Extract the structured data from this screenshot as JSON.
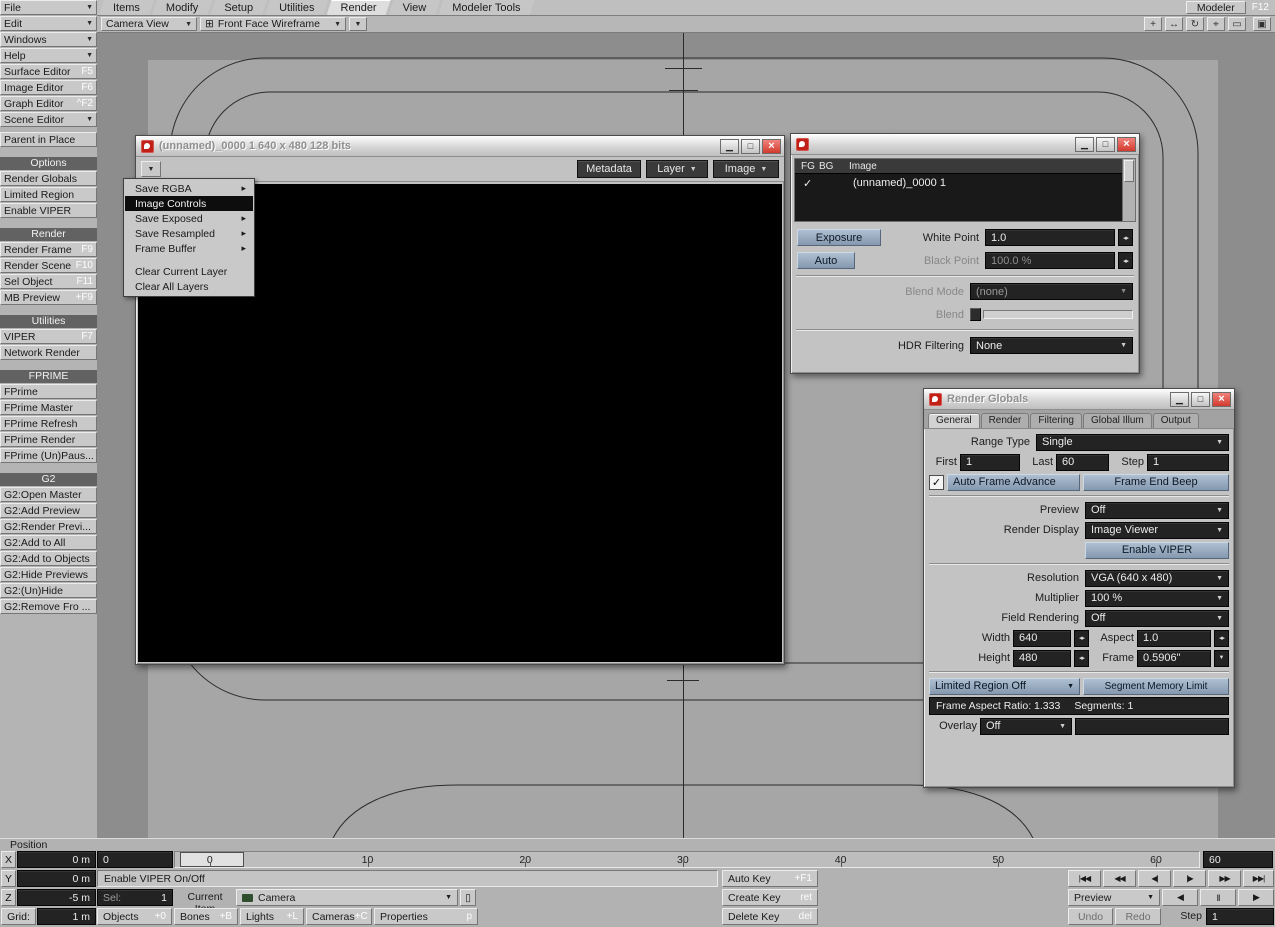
{
  "icons": {
    "dropdown": "▼",
    "dropdown_small": "▾",
    "submenu": "▸",
    "check": "✓",
    "grid_view": "⊞",
    "minimize": "▁",
    "maximize": "□",
    "close": "×",
    "stepper": "◂▸",
    "pan": "+",
    "fit": "↔",
    "rotate": "↻",
    "zoom": "⌖",
    "rect": "▭",
    "single_view": "▣",
    "properties": "▯"
  },
  "menubar": {
    "tabs": [
      "Items",
      "Modify",
      "Setup",
      "Utilities",
      "Render",
      "View",
      "Modeler Tools"
    ],
    "active_tab": "Render",
    "modeler_button": "Modeler",
    "modeler_shortcut": "F12"
  },
  "viewport_toolbar": {
    "view_type": "Camera View",
    "shading": "Front Face Wireframe"
  },
  "sidebar": {
    "menus": [
      "File",
      "Edit",
      "Windows",
      "Help"
    ],
    "items": [
      {
        "label": "Surface Editor",
        "shortcut": "F5"
      },
      {
        "label": "Image Editor",
        "shortcut": "F6"
      },
      {
        "label": "Graph Editor",
        "shortcut": "^F2"
      },
      {
        "label": "Scene Editor",
        "shortcut": ""
      },
      {
        "label": "Parent in Place",
        "shortcut": ""
      },
      {
        "label": "Options"
      },
      {
        "label": "Render Globals",
        "shortcut": ""
      },
      {
        "label": "Limited Region",
        "shortcut": ""
      },
      {
        "label": "Enable VIPER",
        "shortcut": ""
      },
      {
        "label": "Render"
      },
      {
        "label": "Render Frame",
        "shortcut": "F9"
      },
      {
        "label": "Render Scene",
        "shortcut": "F10"
      },
      {
        "label": "Sel Object",
        "shortcut": "F11"
      },
      {
        "label": "MB Preview",
        "shortcut": "+F9"
      },
      {
        "label": "Utilities"
      },
      {
        "label": "VIPER",
        "shortcut": "F7"
      },
      {
        "label": "Network Render",
        "shortcut": ""
      },
      {
        "label": "FPRIME"
      },
      {
        "label": "FPrime",
        "shortcut": ""
      },
      {
        "label": "FPrime Master",
        "shortcut": ""
      },
      {
        "label": "FPrime Refresh",
        "shortcut": ""
      },
      {
        "label": "FPrime Render",
        "shortcut": ""
      },
      {
        "label": "FPrime (Un)Paus...",
        "shortcut": ""
      },
      {
        "label": "G2"
      },
      {
        "label": "G2:Open Master",
        "shortcut": ""
      },
      {
        "label": "G2:Add Preview",
        "shortcut": ""
      },
      {
        "label": "G2:Render Previ...",
        "shortcut": ""
      },
      {
        "label": "G2:Add to All",
        "shortcut": ""
      },
      {
        "label": "G2:Add to Objects",
        "shortcut": ""
      },
      {
        "label": "G2:Hide Previews",
        "shortcut": ""
      },
      {
        "label": "G2:(Un)Hide",
        "shortcut": ""
      },
      {
        "label": "G2:Remove Fro ...",
        "shortcut": ""
      }
    ]
  },
  "image_viewer": {
    "title": "(unnamed)_0000 1  640 x 480 128 bits",
    "metadata_button": "Metadata",
    "layer_dropdown": "Layer",
    "image_dropdown": "Image",
    "context_menu": {
      "items": [
        {
          "label": "Save RGBA",
          "submenu": true
        },
        {
          "label": "Image Controls",
          "selected": true
        },
        {
          "label": "Save Exposed",
          "submenu": true
        },
        {
          "label": "Save Resampled",
          "submenu": true
        },
        {
          "label": "Frame Buffer",
          "submenu": true
        },
        {
          "label": "Clear Current Layer"
        },
        {
          "label": "Clear All Layers"
        }
      ]
    }
  },
  "image_controls": {
    "columns": [
      "FG",
      "BG",
      "Image"
    ],
    "row_name": "(unnamed)_0000 1",
    "exposure": "Exposure",
    "auto": "Auto",
    "white_point_label": "White Point",
    "white_point": "1.0",
    "black_point_label": "Black Point",
    "black_point": "100.0 %",
    "blend_mode_label": "Blend Mode",
    "blend_mode": "(none)",
    "blend_label": "Blend",
    "hdr_label": "HDR Filtering",
    "hdr": "None"
  },
  "render_globals": {
    "title": "Render Globals",
    "tabs": [
      "General",
      "Render",
      "Filtering",
      "Global Illum",
      "Output"
    ],
    "active_tab": "General",
    "range_type_label": "Range Type",
    "range_type": "Single",
    "first_label": "First",
    "first": "1",
    "last_label": "Last",
    "last": "60",
    "step_label": "Step",
    "step": "1",
    "auto_frame_advance": "Auto Frame Advance",
    "frame_end_beep": "Frame End Beep",
    "preview_label": "Preview",
    "preview": "Off",
    "render_display_label": "Render Display",
    "render_display": "Image Viewer",
    "enable_viper": "Enable VIPER",
    "resolution_label": "Resolution",
    "resolution": "VGA (640 x 480)",
    "multiplier_label": "Multiplier",
    "multiplier": "100 %",
    "field_rendering_label": "Field Rendering",
    "field_rendering": "Off",
    "width_label": "Width",
    "width": "640",
    "aspect_label": "Aspect",
    "aspect": "1.0",
    "height_label": "Height",
    "height": "480",
    "frame_label": "Frame",
    "frame": "0.5906\"",
    "limited_region": "Limited Region Off",
    "segment_memory": "Segment Memory Limit",
    "frame_aspect": "Frame Aspect Ratio: 1.333",
    "segments": "Segments: 1",
    "overlay_label": "Overlay",
    "overlay": "Off"
  },
  "timeline": {
    "position_label": "Position",
    "ticks": [
      "0",
      "10",
      "20",
      "30",
      "40",
      "50",
      "60"
    ],
    "current_frame": "0",
    "end_frame": "60"
  },
  "status": {
    "x_label": "X",
    "x_value": "0 m",
    "y_label": "Y",
    "y_value": "0 m",
    "z_label": "Z",
    "z_value": "-5 m",
    "grid_label": "Grid:",
    "grid_value": "1 m",
    "viper_hint": "Enable VIPER On/Off",
    "sel_label": "Sel:",
    "sel_value": "1",
    "current_item_label": "Current Item",
    "current_item": "Camera",
    "item_buttons": [
      {
        "label": "Objects",
        "shortcut": "+0"
      },
      {
        "label": "Bones",
        "shortcut": "+B"
      },
      {
        "label": "Lights",
        "shortcut": "+L"
      },
      {
        "label": "Cameras",
        "shortcut": "+C"
      },
      {
        "label": "Properties",
        "shortcut": "p"
      }
    ],
    "auto_key": {
      "label": "Auto Key",
      "shortcut": "+F1"
    },
    "create_key": {
      "label": "Create Key",
      "shortcut": "ret"
    },
    "delete_key": {
      "label": "Delete Key",
      "shortcut": "del"
    },
    "transport": [
      "|◀◀",
      "◀◀",
      "◀|",
      "|▶",
      "▶▶",
      "▶▶|"
    ],
    "playback": [
      "◀",
      "II",
      "▶"
    ],
    "preview_button": "Preview",
    "undo": "Undo",
    "redo": "Redo",
    "step_label": "Step",
    "step_value": "1"
  },
  "colors": {
    "accent_red": "#c22016",
    "button_blue": "#8fa2b8",
    "field_dark": "#232323",
    "viewport_gray": "#a6a6a6"
  }
}
